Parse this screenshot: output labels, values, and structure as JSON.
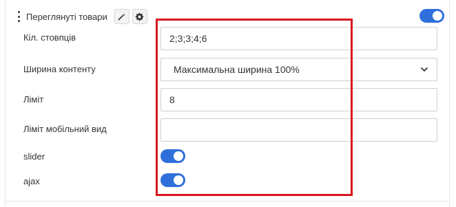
{
  "header": {
    "title": "Переглянуті товари",
    "enabled": true
  },
  "fields": {
    "columns": {
      "label": "Кіл. стовпців",
      "value": "2;3;3;4;6"
    },
    "content_width": {
      "label": "Ширина контенту",
      "selected": "Максимальна ширина 100%"
    },
    "limit": {
      "label": "Ліміт",
      "value": "8"
    },
    "mobile_limit": {
      "label": "Ліміт мобільний вид",
      "value": ""
    },
    "slider": {
      "label": "slider",
      "enabled": true
    },
    "ajax": {
      "label": "ajax",
      "enabled": true
    }
  },
  "icons": [
    "drag-handle-icon",
    "pencil-icon",
    "gear-icon",
    "chevron-down-icon"
  ],
  "colors": {
    "toggle_on": "#2f6fdc",
    "highlight": "#d6161c"
  }
}
